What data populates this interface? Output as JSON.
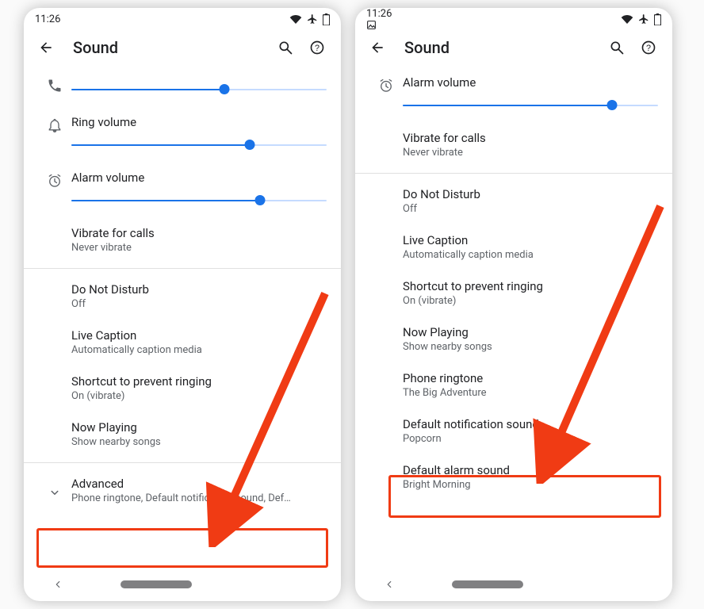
{
  "status": {
    "time": "11:26"
  },
  "appbar": {
    "title": "Sound"
  },
  "left": {
    "ring": {
      "label": "Ring volume",
      "pct": 70
    },
    "media_pct": 60,
    "alarm": {
      "label": "Alarm volume",
      "pct": 74
    },
    "vibrate": {
      "label": "Vibrate for calls",
      "sub": "Never vibrate"
    },
    "dnd": {
      "label": "Do Not Disturb",
      "sub": "Off"
    },
    "caption": {
      "label": "Live Caption",
      "sub": "Automatically caption media"
    },
    "shortcut": {
      "label": "Shortcut to prevent ringing",
      "sub": "On (vibrate)"
    },
    "nowplaying": {
      "label": "Now Playing",
      "sub": "Show nearby songs"
    },
    "advanced": {
      "label": "Advanced",
      "sub": "Phone ringtone, Default notification sound, Def…"
    }
  },
  "right": {
    "alarm": {
      "label": "Alarm volume",
      "pct": 82
    },
    "vibrate": {
      "label": "Vibrate for calls",
      "sub": "Never vibrate"
    },
    "dnd": {
      "label": "Do Not Disturb",
      "sub": "Off"
    },
    "caption": {
      "label": "Live Caption",
      "sub": "Automatically caption media"
    },
    "shortcut": {
      "label": "Shortcut to prevent ringing",
      "sub": "On (vibrate)"
    },
    "nowplaying": {
      "label": "Now Playing",
      "sub": "Show nearby songs"
    },
    "ringtone": {
      "label": "Phone ringtone",
      "sub": "The Big Adventure"
    },
    "notif": {
      "label": "Default notification sound",
      "sub": "Popcorn"
    },
    "alarmsnd": {
      "label": "Default alarm sound",
      "sub": "Bright Morning"
    }
  },
  "colors": {
    "accent": "#1a73e8",
    "highlight": "#f03b14"
  }
}
